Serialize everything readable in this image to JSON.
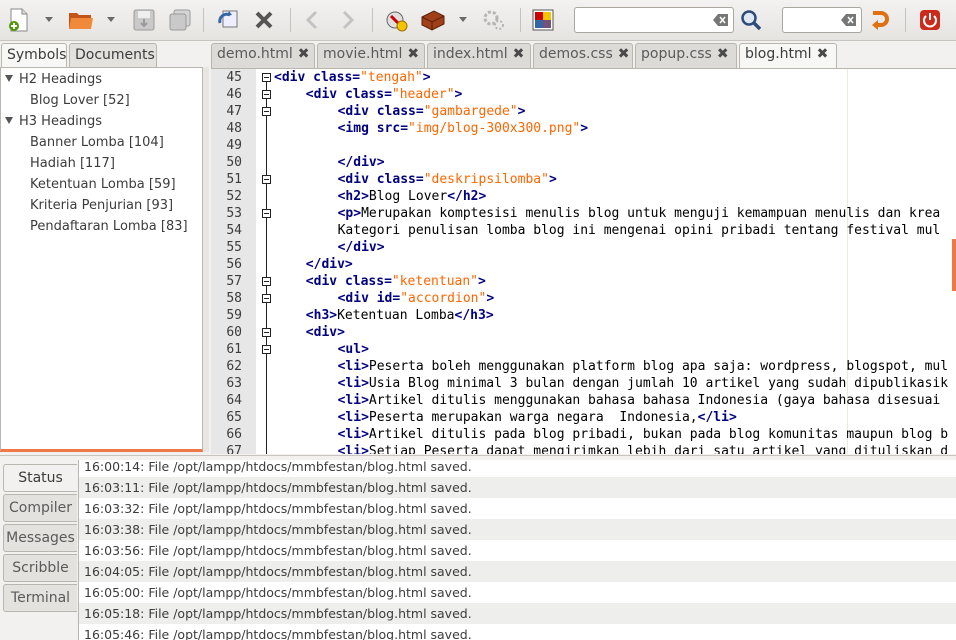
{
  "toolbar": {
    "search_value": "",
    "search2_value": ""
  },
  "left_tabs": [
    {
      "label": "Symbols",
      "active": true
    },
    {
      "label": "Documents",
      "active": false
    }
  ],
  "symbols": {
    "h2": {
      "label": "H2 Headings",
      "items": [
        "Blog Lover [52]"
      ]
    },
    "h3": {
      "label": "H3 Headings",
      "items": [
        "Banner Lomba [104]",
        "Hadiah [117]",
        "Ketentuan Lomba [59]",
        "Kriteria Penjurian [93]",
        "Pendaftaran Lomba [83]"
      ]
    }
  },
  "editor_tabs": [
    {
      "label": "demo.html",
      "active": false
    },
    {
      "label": "movie.html",
      "active": false
    },
    {
      "label": "index.html",
      "active": false
    },
    {
      "label": "demos.css",
      "active": false
    },
    {
      "label": "popup.css",
      "active": false
    },
    {
      "label": "blog.html",
      "active": true
    }
  ],
  "code_lines": [
    {
      "n": "45",
      "fold": true,
      "indent": 0,
      "html": "<span class=\"t\">&lt;div</span> <span class=\"t\">class=</span><span class=\"v\">\"tengah\"</span><span class=\"t\">&gt;</span>"
    },
    {
      "n": "46",
      "fold": true,
      "indent": 1,
      "html": "<span class=\"t\">&lt;div</span> <span class=\"t\">class=</span><span class=\"v\">\"header\"</span><span class=\"t\">&gt;</span>"
    },
    {
      "n": "47",
      "fold": true,
      "indent": 2,
      "html": "<span class=\"t\">&lt;div</span> <span class=\"t\">class=</span><span class=\"v\">\"gambargede\"</span><span class=\"t\">&gt;</span>"
    },
    {
      "n": "48",
      "fold": false,
      "indent": 2,
      "html": "<span class=\"t\">&lt;img</span> <span class=\"t\">src=</span><span class=\"v\">\"img/blog-300x300.png\"</span><span class=\"t\">&gt;</span>"
    },
    {
      "n": "49",
      "fold": false,
      "indent": 0,
      "html": ""
    },
    {
      "n": "50",
      "fold": false,
      "indent": 2,
      "html": "<span class=\"t\">&lt;/div&gt;</span>"
    },
    {
      "n": "51",
      "fold": true,
      "indent": 2,
      "html": "<span class=\"t\">&lt;div</span> <span class=\"t\">class=</span><span class=\"v\">\"deskripsilomba\"</span><span class=\"t\">&gt;</span>"
    },
    {
      "n": "52",
      "fold": false,
      "indent": 2,
      "html": "<span class=\"t\">&lt;h2&gt;</span><span class=\"p\">Blog Lover</span><span class=\"t\">&lt;/h2&gt;</span>"
    },
    {
      "n": "53",
      "fold": true,
      "indent": 2,
      "html": "<span class=\"t\">&lt;p&gt;</span><span class=\"p\">Merupakan komptesisi menulis blog untuk menguji kemampuan menulis dan krea</span>"
    },
    {
      "n": "54",
      "fold": false,
      "indent": 2,
      "html": "<span class=\"p\">Kategori penulisan lomba blog ini mengenai opini pribadi tentang festival mul</span>"
    },
    {
      "n": "55",
      "fold": false,
      "indent": 2,
      "html": "<span class=\"t\">&lt;/div&gt;</span>"
    },
    {
      "n": "56",
      "fold": false,
      "indent": 1,
      "html": "<span class=\"t\">&lt;/div&gt;</span>"
    },
    {
      "n": "57",
      "fold": true,
      "indent": 1,
      "html": "<span class=\"t\">&lt;div</span> <span class=\"t\">class=</span><span class=\"v\">\"ketentuan\"</span><span class=\"t\">&gt;</span>"
    },
    {
      "n": "58",
      "fold": true,
      "indent": 2,
      "html": "<span class=\"t\">&lt;div</span> <span class=\"t\">id=</span><span class=\"v\">\"accordion\"</span><span class=\"t\">&gt;</span>"
    },
    {
      "n": "59",
      "fold": false,
      "indent": 1,
      "html": "<span class=\"t\">&lt;h3&gt;</span><span class=\"p\">Ketentuan Lomba</span><span class=\"t\">&lt;/h3&gt;</span>"
    },
    {
      "n": "60",
      "fold": true,
      "indent": 1,
      "html": "<span class=\"t\">&lt;div&gt;</span>"
    },
    {
      "n": "61",
      "fold": true,
      "indent": 2,
      "html": "<span class=\"t\">&lt;ul&gt;</span>"
    },
    {
      "n": "62",
      "fold": false,
      "indent": 2,
      "html": "<span class=\"t\">&lt;li&gt;</span><span class=\"p\">Peserta boleh menggunakan platform blog apa saja: wordpress, blogspot, mul</span>"
    },
    {
      "n": "63",
      "fold": false,
      "indent": 2,
      "html": "<span class=\"t\">&lt;li&gt;</span><span class=\"p\">Usia Blog minimal 3 bulan dengan jumlah 10 artikel yang sudah dipublikasik</span>"
    },
    {
      "n": "64",
      "fold": false,
      "indent": 2,
      "html": "<span class=\"t\">&lt;li&gt;</span><span class=\"p\">Artikel ditulis menggunakan bahasa bahasa Indonesia (gaya bahasa disesuai</span>"
    },
    {
      "n": "65",
      "fold": false,
      "indent": 2,
      "html": "<span class=\"t\">&lt;li&gt;</span><span class=\"p\">Peserta merupakan warga negara  Indonesia,</span><span class=\"t\">&lt;/li&gt;</span>"
    },
    {
      "n": "66",
      "fold": false,
      "indent": 2,
      "html": "<span class=\"t\">&lt;li&gt;</span><span class=\"p\">Artikel ditulis pada blog pribadi, bukan pada blog komunitas maupun blog b</span>"
    },
    {
      "n": "67",
      "fold": false,
      "indent": 2,
      "html": "<span class=\"t\">&lt;li&gt;</span><span class=\"p\">Setiap Peserta dapat mengirimkan lebih dari satu artikel yang dituliskan d</span>"
    }
  ],
  "msg_tabs": [
    {
      "label": "Status",
      "active": true
    },
    {
      "label": "Compiler",
      "active": false
    },
    {
      "label": "Messages",
      "active": false
    },
    {
      "label": "Scribble",
      "active": false
    },
    {
      "label": "Terminal",
      "active": false
    }
  ],
  "log": [
    "16:00:14: File /opt/lampp/htdocs/mmbfestan/blog.html saved.",
    "16:03:11: File /opt/lampp/htdocs/mmbfestan/blog.html saved.",
    "16:03:32: File /opt/lampp/htdocs/mmbfestan/blog.html saved.",
    "16:03:38: File /opt/lampp/htdocs/mmbfestan/blog.html saved.",
    "16:03:56: File /opt/lampp/htdocs/mmbfestan/blog.html saved.",
    "16:04:05: File /opt/lampp/htdocs/mmbfestan/blog.html saved.",
    "16:05:00: File /opt/lampp/htdocs/mmbfestan/blog.html saved.",
    "16:05:18: File /opt/lampp/htdocs/mmbfestan/blog.html saved.",
    "16:05:46: File /opt/lampp/htdocs/mmbfestan/blog.html saved."
  ],
  "colors": {
    "accent": "#f07746",
    "tag": "#000080",
    "attr_value": "#ff6600"
  }
}
